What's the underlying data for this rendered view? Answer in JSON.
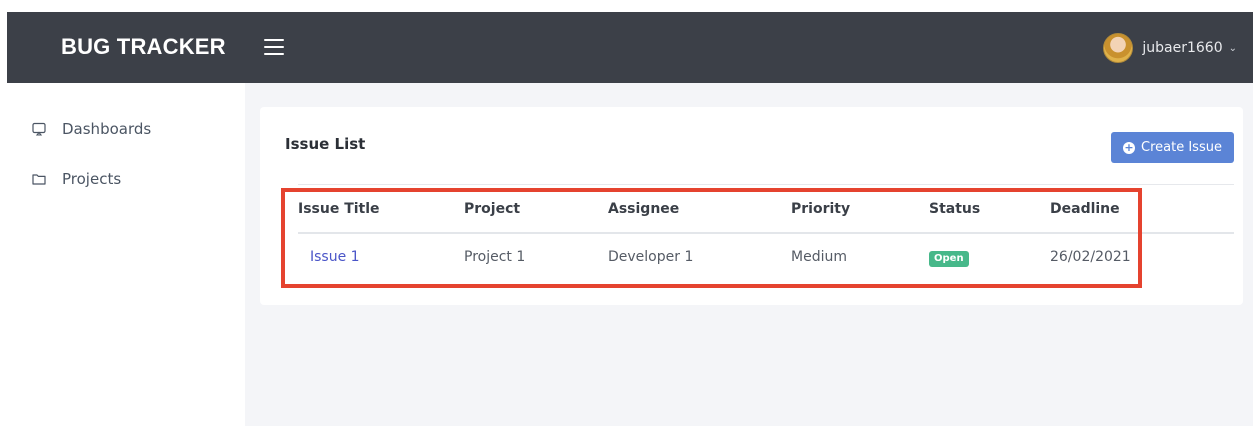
{
  "navbar": {
    "brand": "BUG TRACKER",
    "username": "jubaer1660",
    "colors": {
      "background": "#3c4048",
      "text": "#ffffff"
    }
  },
  "sidebar": {
    "items": [
      {
        "label": "Dashboards",
        "icon": "monitor-icon"
      },
      {
        "label": "Projects",
        "icon": "folder-icon"
      }
    ]
  },
  "main": {
    "title": "Issue List",
    "create_button": "Create Issue",
    "table": {
      "columns": [
        "Issue Title",
        "Project",
        "Assignee",
        "Priority",
        "Status",
        "Deadline"
      ],
      "rows": [
        {
          "issue_title": "Issue 1",
          "project": "Project 1",
          "assignee": "Developer 1",
          "priority": "Medium",
          "status": "Open",
          "deadline": "26/02/2021"
        }
      ]
    }
  },
  "colors": {
    "accent": "#5b84d6",
    "status_open": "#47b88a",
    "link": "#4a55c8",
    "highlight_border": "#e5432f"
  }
}
